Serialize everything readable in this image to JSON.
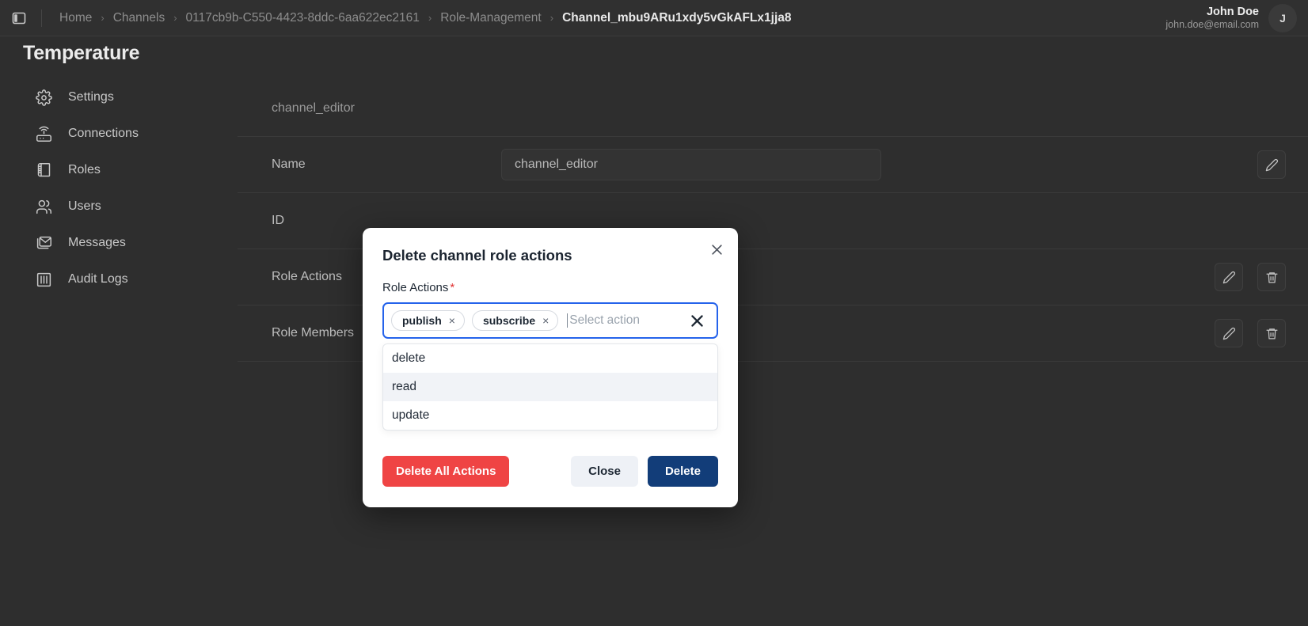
{
  "topbar": {
    "panel_toggle_icon": "sidebar-toggle-icon",
    "breadcrumb": [
      {
        "label": "Home",
        "current": false
      },
      {
        "label": "Channels",
        "current": false
      },
      {
        "label": "0117cb9b-C550-4423-8ddc-6aa622ec2161",
        "current": false
      },
      {
        "label": "Role-Management",
        "current": false
      },
      {
        "label": "Channel_mbu9ARu1xdy5vGkAFLx1jja8",
        "current": true
      }
    ],
    "separator": "›",
    "user": {
      "name": "John Doe",
      "email": "john.doe@email.com",
      "avatar_initial": "J"
    }
  },
  "page": {
    "title": "Temperature"
  },
  "sidebar": {
    "items": [
      {
        "label": "Settings",
        "icon": "gear-icon"
      },
      {
        "label": "Connections",
        "icon": "router-icon"
      },
      {
        "label": "Roles",
        "icon": "book-icon"
      },
      {
        "label": "Users",
        "icon": "users-icon"
      },
      {
        "label": "Messages",
        "icon": "envelope-icon"
      },
      {
        "label": "Audit Logs",
        "icon": "audit-logs-icon"
      }
    ]
  },
  "main": {
    "role_heading": "channel_editor",
    "rows": [
      {
        "label": "Name",
        "value": "channel_editor",
        "has_edit": true,
        "has_delete": false
      },
      {
        "label": "ID",
        "value": "",
        "has_edit": false,
        "has_delete": false
      },
      {
        "label": "Role Actions",
        "value": "",
        "has_edit": true,
        "has_delete": true
      },
      {
        "label": "Role Members",
        "value": "",
        "has_edit": true,
        "has_delete": true
      }
    ]
  },
  "modal": {
    "title": "Delete channel role actions",
    "close_icon": "close-icon",
    "field_label": "Role Actions",
    "required_mark": "*",
    "chips": [
      {
        "label": "publish",
        "remove": "×"
      },
      {
        "label": "subscribe",
        "remove": "×"
      }
    ],
    "placeholder": "Select action",
    "clear_icon": "clear-icon",
    "options": [
      {
        "label": "delete",
        "active": false
      },
      {
        "label": "read",
        "active": true
      },
      {
        "label": "update",
        "active": false
      }
    ],
    "buttons": {
      "delete_all": "Delete All Actions",
      "close": "Close",
      "delete": "Delete"
    }
  },
  "colors": {
    "accent_blue": "#2563eb",
    "danger_red": "#ef4444",
    "primary_navy": "#123d79",
    "required_red": "#e03131"
  }
}
